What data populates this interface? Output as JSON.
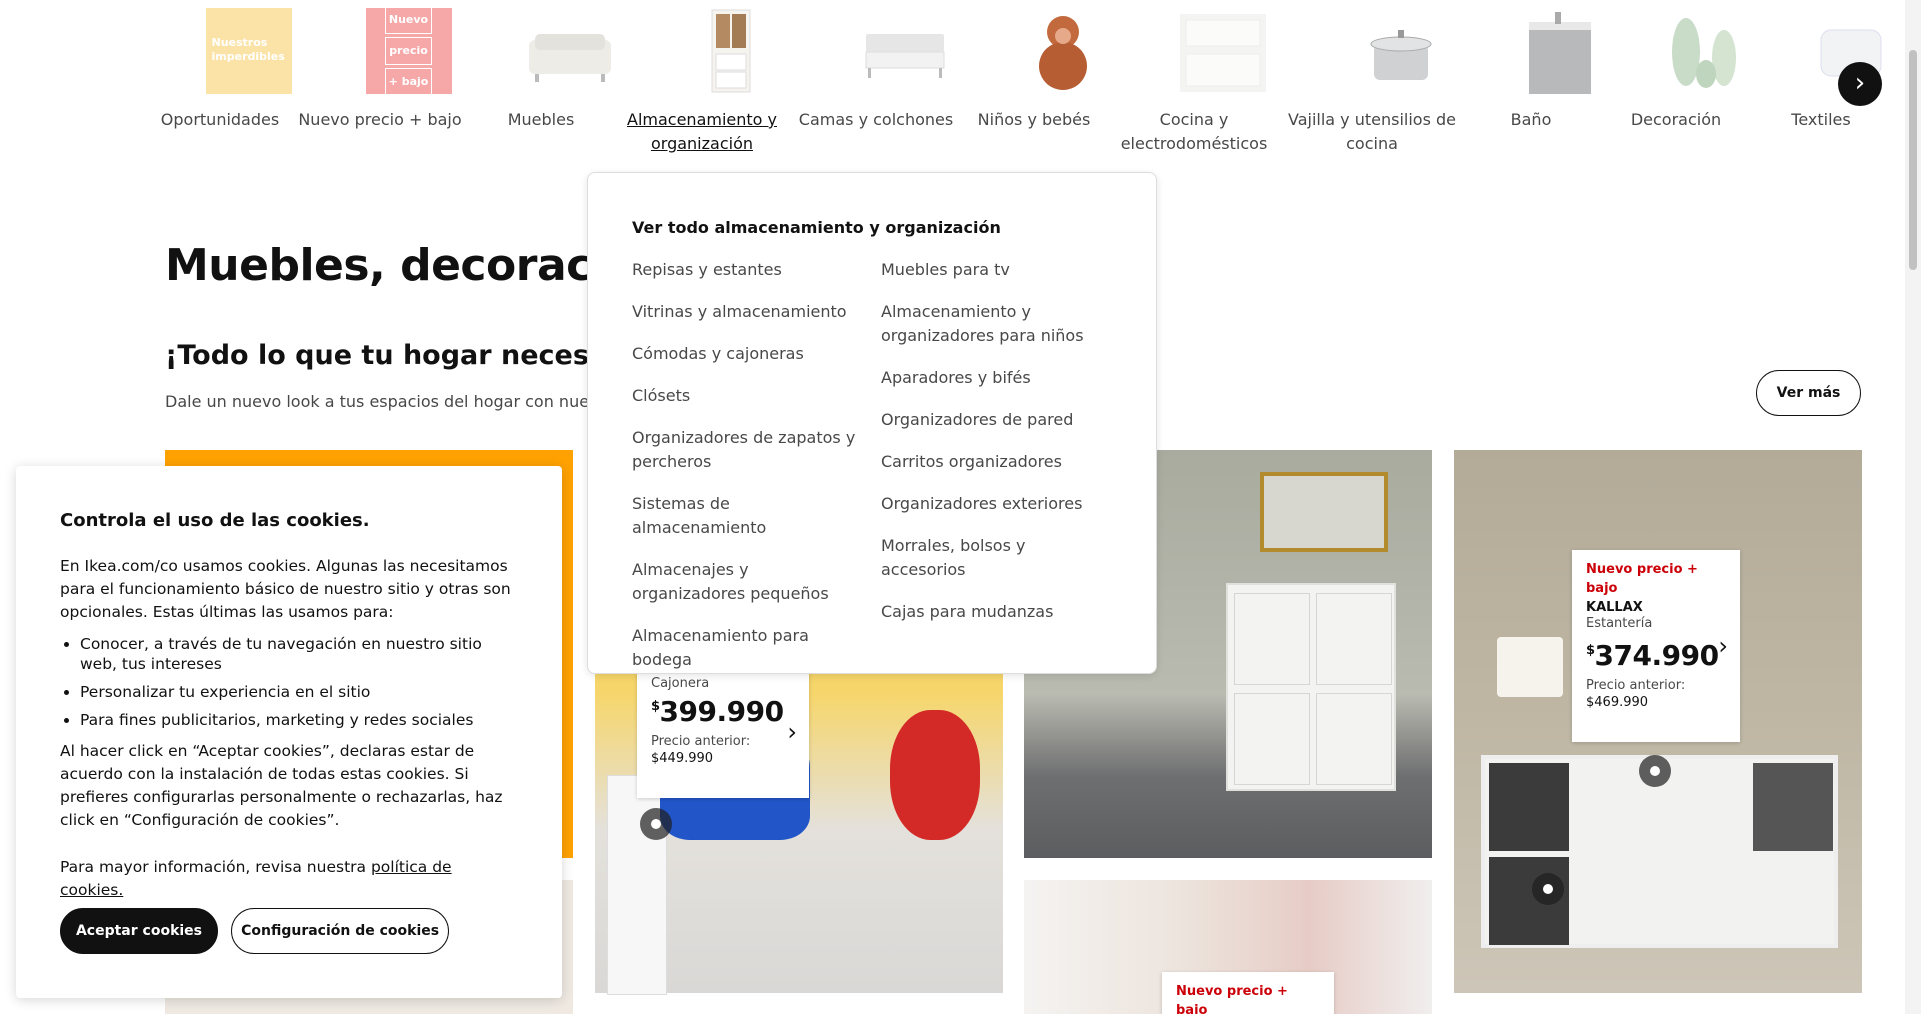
{
  "categories": [
    {
      "label": "Oportunidades",
      "thumb_text": "Nuestros imperdibles"
    },
    {
      "label": "Nuevo precio + bajo",
      "thumb_text": [
        "Nuevo",
        "precio",
        "+ bajo"
      ]
    },
    {
      "label": "Muebles"
    },
    {
      "label": "Almacenamiento y organización",
      "active": true
    },
    {
      "label": "Camas y colchones"
    },
    {
      "label": "Niños y bebés"
    },
    {
      "label": "Cocina y electrodomésticos"
    },
    {
      "label": "Vajilla y utensilios de cocina"
    },
    {
      "label": "Baño"
    },
    {
      "label": "Decoración"
    },
    {
      "label": "Textiles"
    }
  ],
  "scroll_next_glyph": "›",
  "main": {
    "title": "Muebles, decoración e",
    "subtitle": "¡Todo lo que tu hogar necesita a",
    "description": "Dale un nuevo look a tus espacios del hogar con nuestros in",
    "ver_mas": "Ver más"
  },
  "mega_menu": {
    "see_all": "Ver todo almacenamiento y organización",
    "col1": [
      "Repisas y estantes",
      "Vitrinas y almacenamiento",
      "Cómodas y cajoneras",
      "Clósets",
      "Organizadores de zapatos y percheros",
      "Sistemas de almacenamiento",
      "Almacenajes y organizadores pequeños",
      "Almacenamiento para bodega"
    ],
    "col2": [
      "Muebles para tv",
      "Almacenamiento y organizadores para niños",
      "Aparadores y bifés",
      "Organizadores de pared",
      "Carritos organizadores",
      "Organizadores exteriores",
      "Morrales, bolsos y accesorios",
      "Cajas para mudanzas"
    ]
  },
  "products": {
    "kallax": {
      "tag": "Nuevo precio + bajo",
      "name": "KALLAX",
      "type": "Estantería",
      "currency": "$",
      "price": "374.990",
      "prev_label": "Precio anterior:",
      "prev_price": "$469.990"
    },
    "office": {
      "type": "Cajonera",
      "currency": "$",
      "price": "399.990",
      "prev_label": "Precio anterior:",
      "prev_price": "$449.990"
    },
    "curtain": {
      "tag": "Nuevo precio + bajo"
    },
    "chevron": "›"
  },
  "cookies": {
    "title": "Controla el uso de las cookies.",
    "intro": "En Ikea.com/co usamos cookies. Algunas las necesitamos para el funcionamiento básico de nuestro sitio y otras son opcionales. Estas últimas las usamos para:",
    "bullets": [
      "Conocer, a través de tu navegación en nuestro sitio web, tus intereses",
      "Personalizar tu experiencia en el sitio",
      "Para fines publicitarios, marketing y redes sociales"
    ],
    "consent": "Al hacer click en “Aceptar cookies”, declaras estar de acuerdo con la instalación de todas estas cookies. Si prefieres configurarlas personalmente o rechazarlas, haz click en “Configuración de cookies”.",
    "more_info": "Para mayor información, revisa nuestra ",
    "policy_link": "política de cookies.",
    "accept": "Aceptar cookies",
    "configure": "Configuración de cookies"
  }
}
